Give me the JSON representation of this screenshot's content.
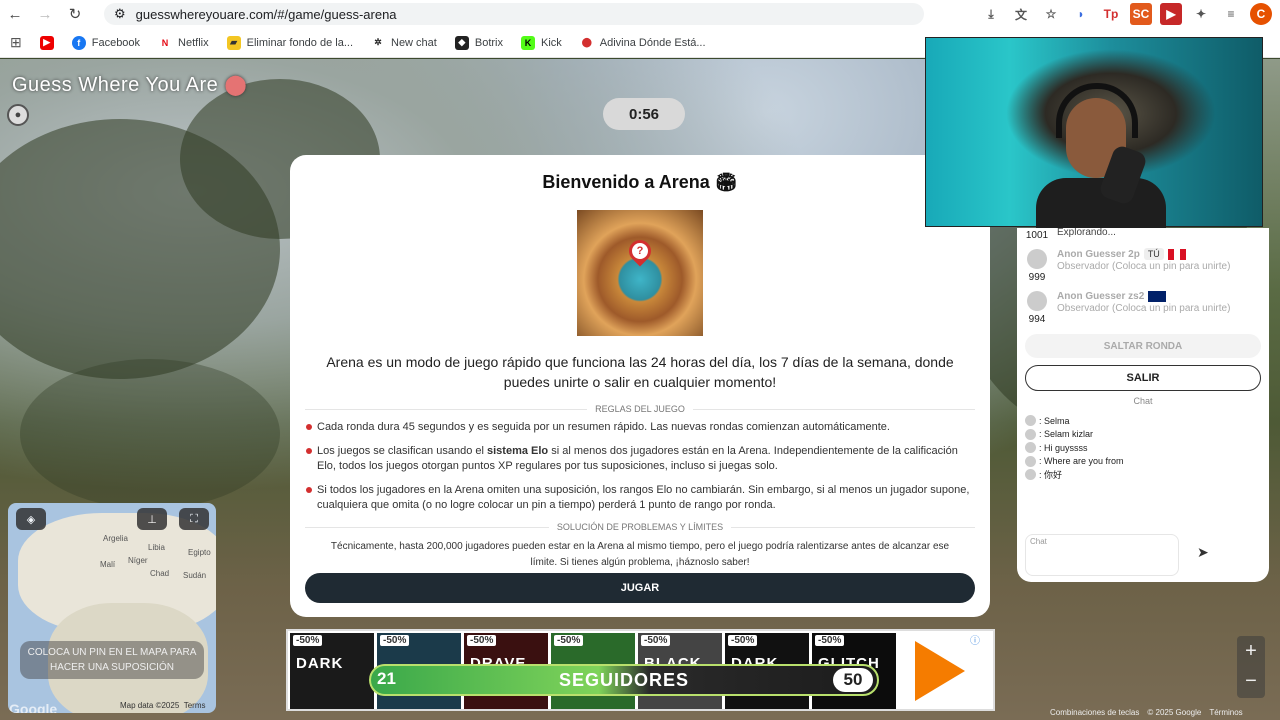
{
  "browser": {
    "url": "guesswhereyouare.com/#/game/guess-arena",
    "profile_initial": "C",
    "bookmarks": [
      "Facebook",
      "Netflix",
      "Eliminar fondo de la...",
      "New chat",
      "Botrix",
      "Kick",
      "Adivina Dónde Está..."
    ]
  },
  "game": {
    "title": "Guess Where You Are",
    "timer": "0:56"
  },
  "modal": {
    "title": "Bienvenido a Arena",
    "intro": "Arena es un modo de juego rápido que funciona las 24 horas del día, los 7 días de la semana, donde puedes unirte o salir en cualquier momento!",
    "rules_header": "REGLAS DEL JUEGO",
    "rule1": "Cada ronda dura 45 segundos y es seguida por un resumen rápido. Las nuevas rondas comienzan automáticamente.",
    "rule2_pre": "Los juegos se clasifican usando el ",
    "rule2_bold": "sistema Elo",
    "rule2_post": " si al menos dos jugadores están en la Arena. Independientemente de la calificación Elo, todos los juegos otorgan puntos XP regulares por tus suposiciones, incluso si juegas solo.",
    "rule3": "Si todos los jugadores en la Arena omiten una suposición, los rangos Elo no cambiarán. Sin embargo, si al menos un jugador supone, cualquiera que omita (o no logre colocar un pin a tiempo) perderá 1 punto de rango por ronda.",
    "trouble_header": "SOLUCIÓN DE PROBLEMAS Y LÍMITES",
    "trouble": "Técnicamente, hasta 200,000 jugadores pueden estar en la Arena al mismo tiempo, pero el juego podría ralentizarse antes de alcanzar ese límite. Si tienes algún problema, ¡háznoslo saber!",
    "play_label": "JUGAR"
  },
  "players": [
    {
      "score": "1001",
      "name": "",
      "status": "Explorando..."
    },
    {
      "score": "999",
      "name": "Anon Guesser 2p",
      "badge": "TÚ",
      "status": "Observador (Coloca un pin para unirte)"
    },
    {
      "score": "994",
      "name": "Anon Guesser zs2",
      "status": "Observador (Coloca un pin para unirte)"
    }
  ],
  "panel": {
    "skip_label": "SALTAR RONDA",
    "leave_label": "SALIR",
    "chat_header": "Chat",
    "chat_placeholder": "Chat",
    "messages": [
      ": Selma",
      ": Selam kizlar",
      ": Hi guyssss",
      ": Where are you from",
      ": 你好"
    ]
  },
  "minimap": {
    "place_pin": "COLOCA UN PIN EN EL MAPA PARA HACER UNA SUPOSICIÓN",
    "labels": [
      "Argelia",
      "Libia",
      "Egipto",
      "Malí",
      "Níger",
      "Chad",
      "Sudán"
    ],
    "attrib": "Map data ©2025",
    "terms": "Terms",
    "brand": "Google"
  },
  "ad": {
    "tiles": [
      {
        "discount": "-50%",
        "name": "DARK"
      },
      {
        "discount": "-50%",
        "name": ""
      },
      {
        "discount": "-50%",
        "name": "DRAVE"
      },
      {
        "discount": "-50%",
        "name": ""
      },
      {
        "discount": "-50%",
        "name": "BLACK"
      },
      {
        "discount": "-50%",
        "name": "DARK"
      },
      {
        "discount": "-50%",
        "name": "GLITCH"
      }
    ],
    "followers_current": "21",
    "followers_label": "SEGUIDORES",
    "followers_goal": "50"
  },
  "footer": [
    "Combinaciones de teclas",
    "© 2025 Google",
    "Términos"
  ],
  "colors": {
    "accent_red": "#d32f2f",
    "play_btn": "#1f2a33",
    "bar_green": "#3aa84a"
  }
}
